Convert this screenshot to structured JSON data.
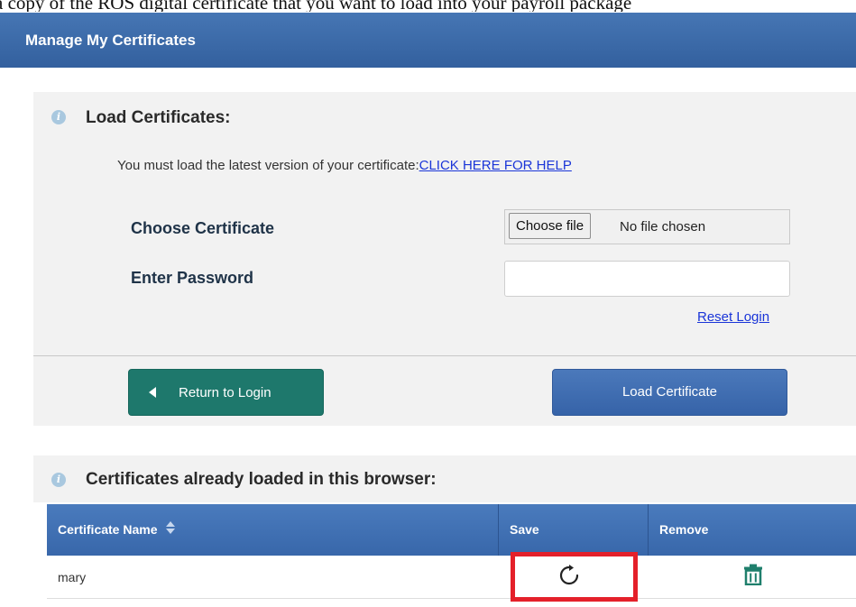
{
  "caption": "a copy of the ROS digital certificate that you want to load into your payroll package",
  "header": {
    "title": "Manage My Certificates"
  },
  "load_section": {
    "title": "Load Certificates:",
    "help_text": "You must load the latest version of your certificate:",
    "help_link": "CLICK HERE FOR HELP",
    "choose_label": "Choose Certificate",
    "choose_button": "Choose file",
    "choose_status": "No file chosen",
    "password_label": "Enter Password",
    "password_value": "",
    "reset_link": "Reset Login",
    "return_button": "Return to Login",
    "load_button": "Load Certificate"
  },
  "loaded_section": {
    "title": "Certificates already loaded in this browser:",
    "columns": [
      "Certificate Name",
      "Save",
      "Remove"
    ],
    "rows": [
      {
        "name": "mary"
      }
    ]
  },
  "colors": {
    "header_blue": "#3a68a8",
    "return_green": "#1e786c",
    "remove_icon_green": "#1f7f6c",
    "highlight_red": "#e4202a"
  },
  "icons": {
    "info": "info-icon",
    "sort": "sort-icon",
    "save": "refresh-icon",
    "remove": "trash-icon",
    "back": "caret-left-icon"
  }
}
